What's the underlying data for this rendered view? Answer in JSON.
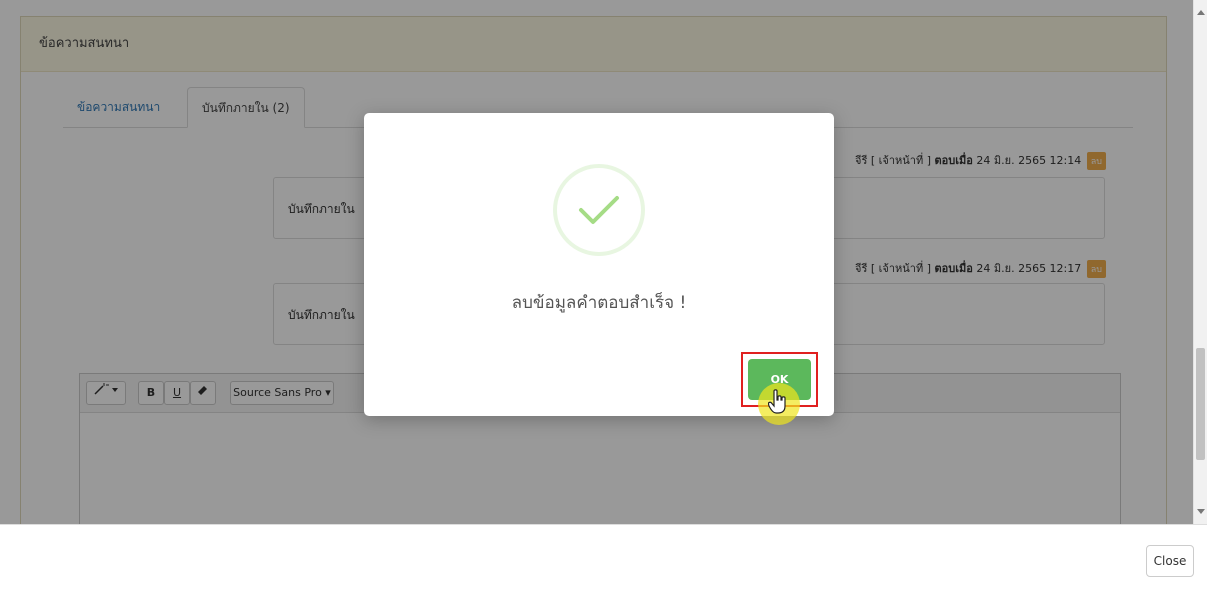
{
  "panel": {
    "title": "ข้อความสนทนา",
    "tabs": [
      {
        "label": "ข้อความสนทนา",
        "active": false
      },
      {
        "label": "บันทึกภายใน (2)",
        "active": true
      }
    ]
  },
  "notes": [
    {
      "author": "จีรี [ เจ้าหน้าที่ ]",
      "replied_label": "ตอบเมื่อ",
      "timestamp": "24 มิ.ย. 2565 12:14",
      "delete_label": "ลบ",
      "text": "บันทึกภายใน"
    },
    {
      "author": "จีรี [ เจ้าหน้าที่ ]",
      "replied_label": "ตอบเมื่อ",
      "timestamp": "24 มิ.ย. 2565 12:17",
      "delete_label": "ลบ",
      "text": "บันทึกภายใน"
    }
  ],
  "editor": {
    "toolbar": {
      "bold": "B",
      "underline": "U",
      "font_name": "Source Sans Pro ▾"
    }
  },
  "modal": {
    "icon": "success-check-icon",
    "message": "ลบข้อมูลคำตอบสำเร็จ !",
    "ok_label": "OK",
    "accent_color": "#5cb85c",
    "check_color": "#a5dc86"
  },
  "footer": {
    "close_label": "Close"
  },
  "colors": {
    "panel_heading_bg": "#fcf8e3",
    "badge_bg": "#f0ad4e",
    "highlight_border": "#e02020"
  }
}
